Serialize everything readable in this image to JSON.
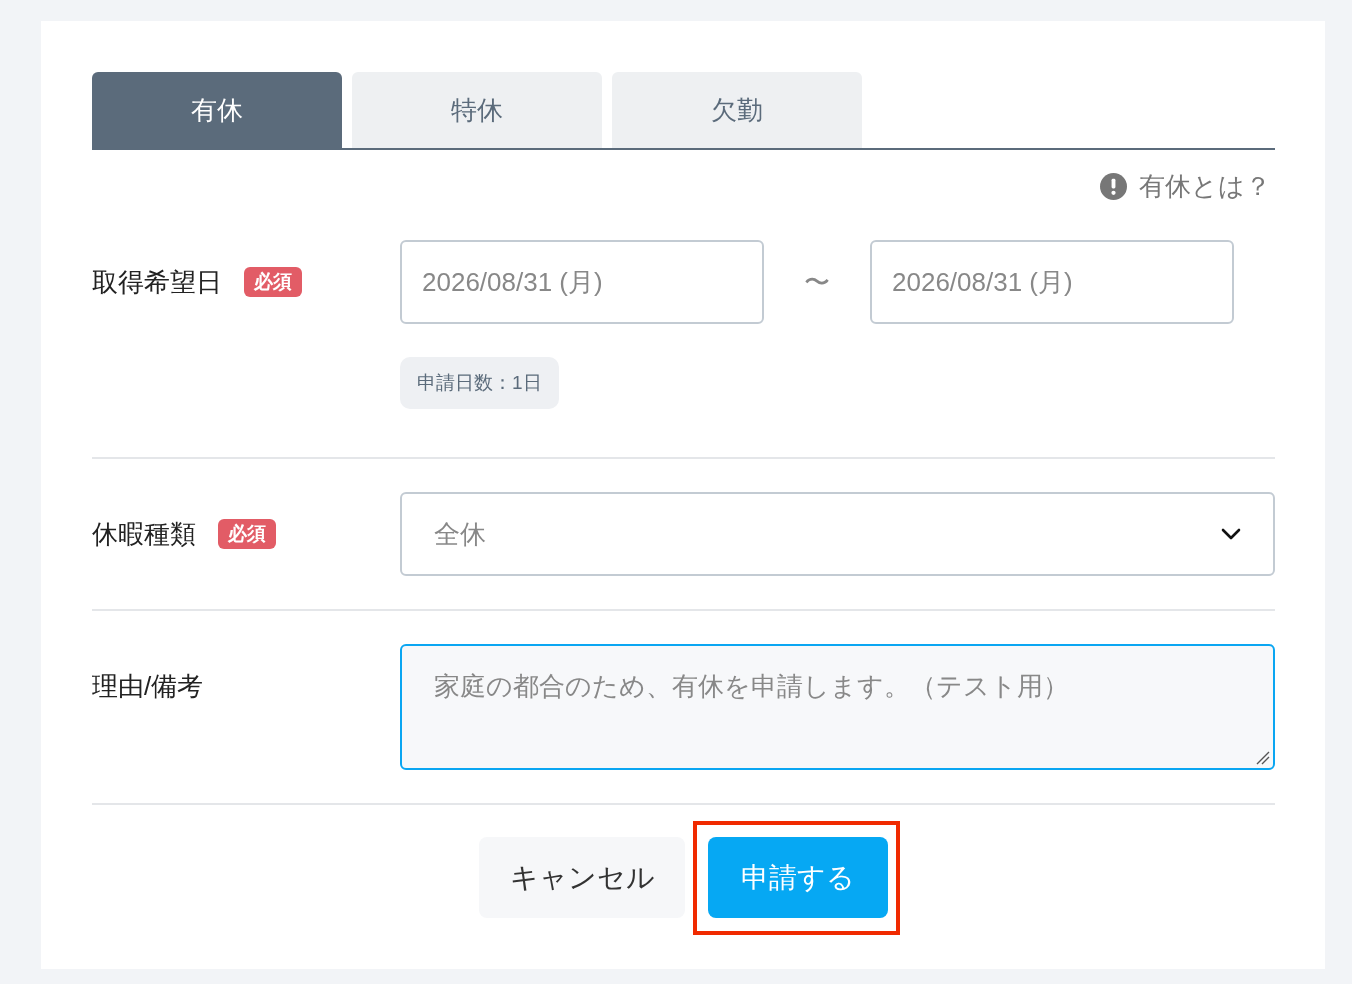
{
  "tabs": [
    {
      "label": "有休",
      "selected": true
    },
    {
      "label": "特休",
      "selected": false
    },
    {
      "label": "欠勤",
      "selected": false
    }
  ],
  "help_link": {
    "label": "有休とは？"
  },
  "form_rows": [
    {
      "kind": "date_range",
      "label": "取得希望日",
      "badge": "必須",
      "start_date": "2026/08/31 (月)",
      "separator": "〜",
      "end_date": "2026/08/31 (月)",
      "day_count": "申請日数：1日"
    },
    {
      "kind": "select",
      "label": "休暇種類",
      "badge": "必須",
      "value": "全休"
    },
    {
      "kind": "textarea",
      "label": "理由/備考",
      "value": "家庭の都合のため、有休を申請します。（テスト用）",
      "focused": true
    }
  ],
  "buttons": [
    {
      "label": "キャンセル",
      "kind": "secondary",
      "highlighted": false
    },
    {
      "label": "申請する",
      "kind": "primary",
      "highlighted": true
    }
  ]
}
